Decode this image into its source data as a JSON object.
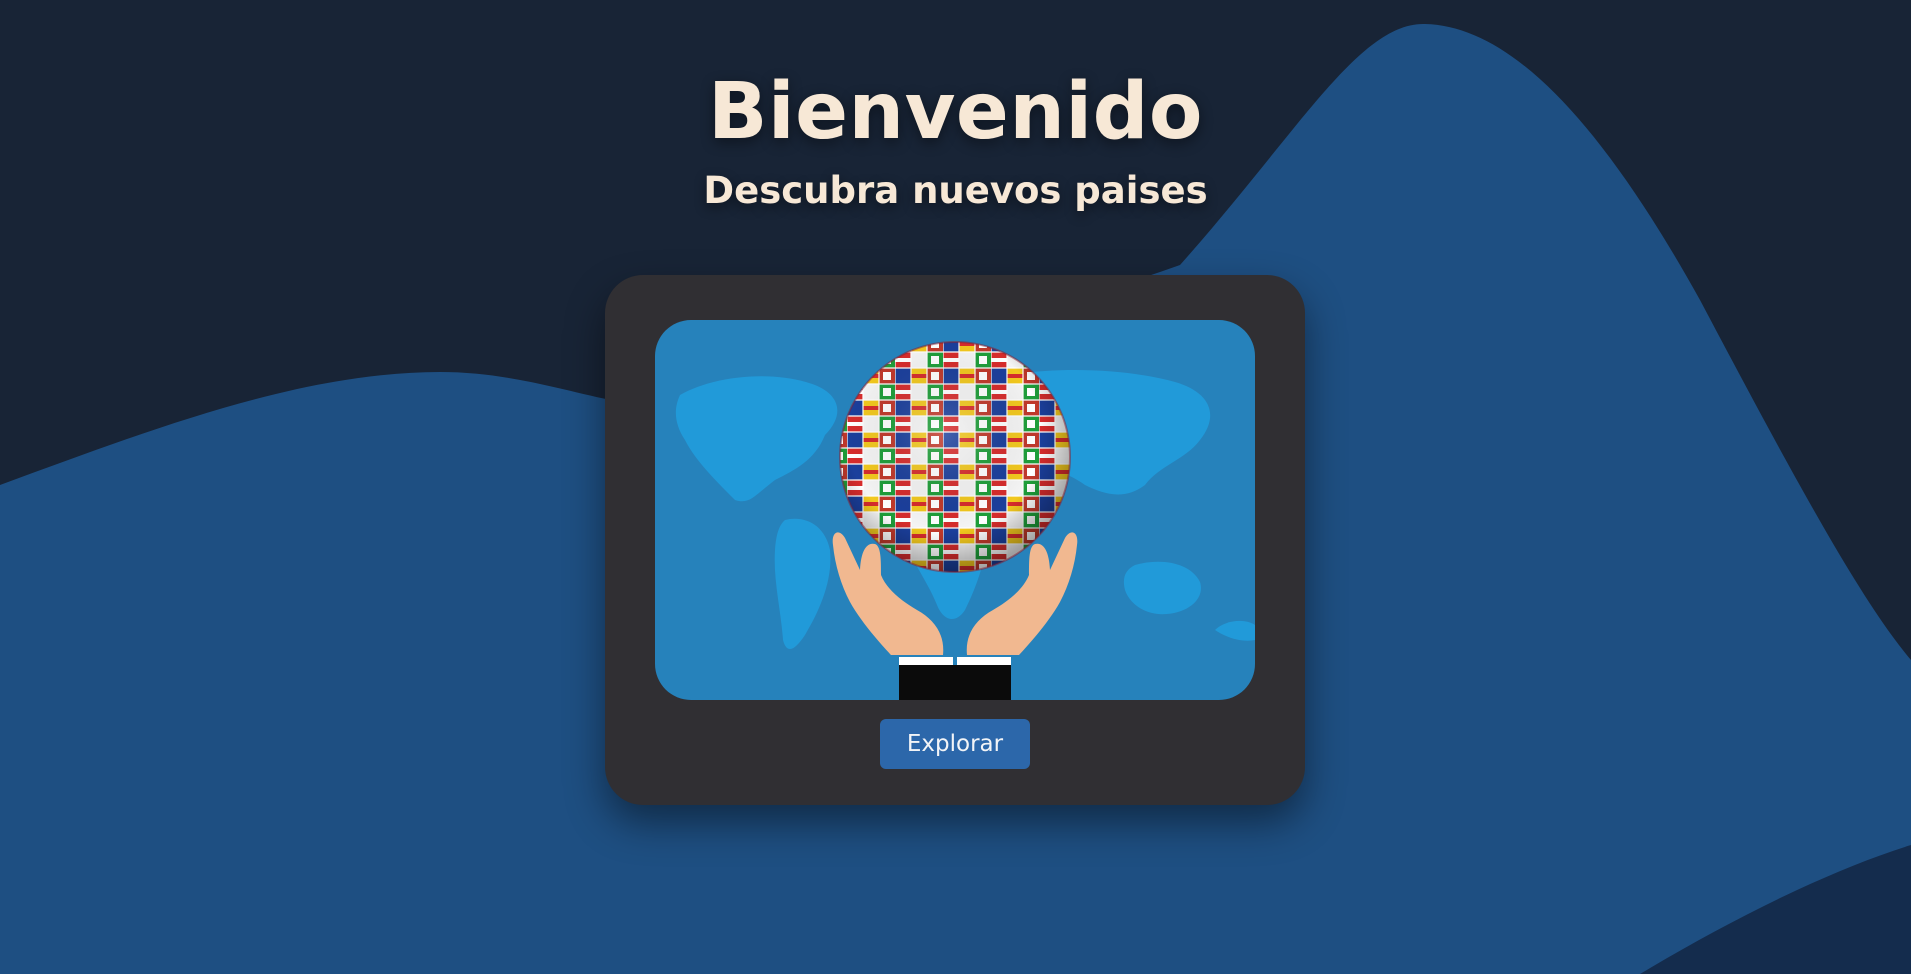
{
  "hero": {
    "title": "Bienvenido",
    "subtitle": "Descubra nuevos paises"
  },
  "card": {
    "illustration": "globe-of-flags-held-by-hands",
    "explore_label": "Explorar"
  },
  "colors": {
    "background_dark": "#182436",
    "wave_blue": "#1e4f82",
    "card": "#302f33",
    "button": "#2c67aa",
    "title_text": "#f7e8d6",
    "map_ocean": "#2682bb",
    "map_land": "#219ad9"
  }
}
